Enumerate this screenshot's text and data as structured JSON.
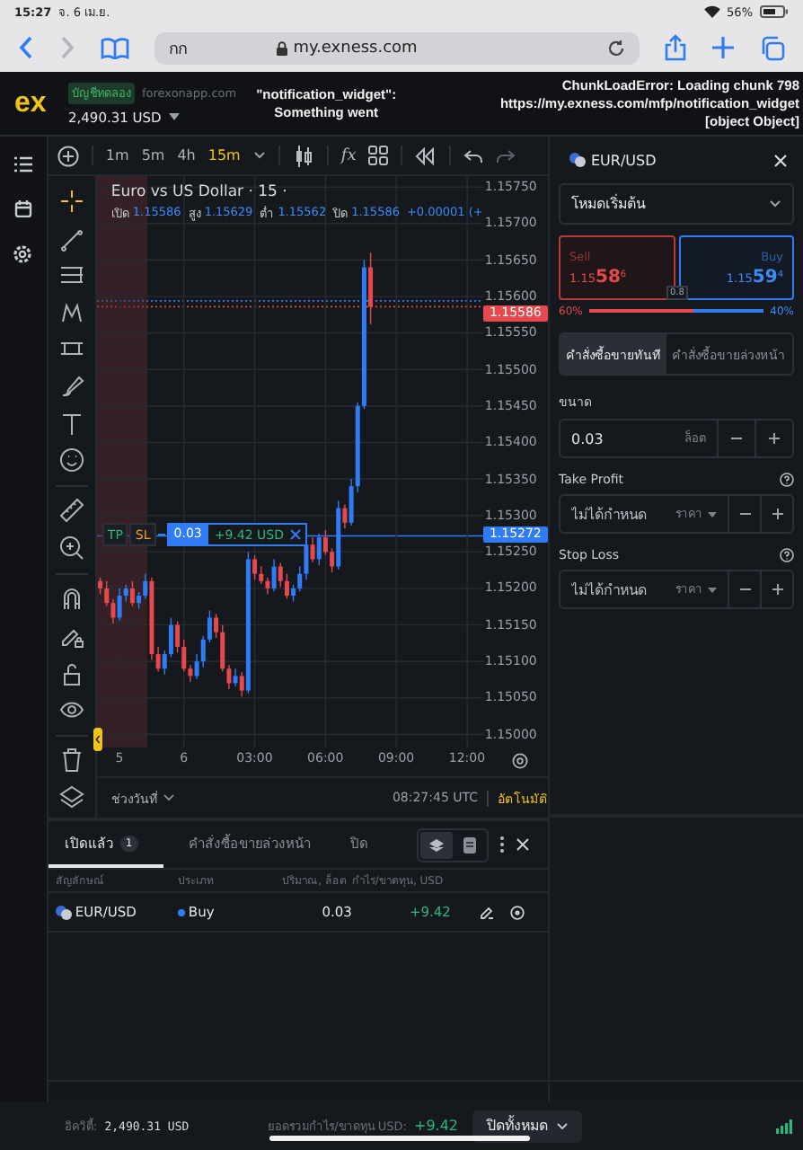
{
  "status_bar": {
    "time": "15:27",
    "date": "จ. 6 เม.ย.",
    "battery": "56%"
  },
  "browser": {
    "address_text": "กก",
    "url": "my.exness.com"
  },
  "app_header": {
    "logo": "ex",
    "account_badge": "บัญชีทดลอง",
    "site": "forexonapp.com",
    "balance": "2,490.31 USD",
    "error_notices": [
      {
        "lines": [
          "\"notification_widget\":",
          "Something went"
        ]
      },
      {
        "lines": [
          "ChunkLoadError: Loading chunk 798",
          "https://my.exness.com/mfp/notification_widget",
          "[object Object]"
        ]
      }
    ]
  },
  "chart_toolbar": {
    "intervals": [
      {
        "label": "1m",
        "selected": false
      },
      {
        "label": "5m",
        "selected": false
      },
      {
        "label": "4h",
        "selected": false
      },
      {
        "label": "15m",
        "selected": true
      }
    ],
    "indicators": "fx"
  },
  "chart": {
    "title": "Euro vs US Dollar · 15 ·",
    "ohlc": [
      {
        "label": "เปิด",
        "value": "1.15586"
      },
      {
        "label": "สูง",
        "value": "1.15629"
      },
      {
        "label": "ต่ำ",
        "value": "1.15562"
      },
      {
        "label": "ปิด",
        "value": "1.15586"
      }
    ],
    "change": "+0.00001 (+",
    "chart_data": {
      "type": "candlestick",
      "categories": [
        null,
        null,
        null,
        "5",
        null,
        null,
        null,
        null,
        null,
        null,
        null,
        null,
        null,
        "6",
        null,
        null,
        null,
        null,
        null,
        null,
        null,
        null,
        null,
        null,
        "03:00",
        null,
        null,
        null,
        null,
        null,
        null,
        null,
        null,
        null,
        null,
        "06:00",
        null,
        null,
        null,
        null,
        null,
        null,
        null,
        null,
        null,
        null,
        "09:00",
        null,
        null,
        null,
        null,
        null,
        null,
        null,
        null,
        null,
        null,
        "12:00",
        null,
        null
      ],
      "ohlc": [
        [
          1.1521,
          1.15215,
          1.15192,
          1.152
        ],
        [
          1.152,
          1.1521,
          1.15176,
          1.1518
        ],
        [
          1.1518,
          1.15185,
          1.15152,
          1.1516
        ],
        [
          1.1516,
          1.152,
          1.15156,
          1.1519
        ],
        [
          1.1519,
          1.15205,
          1.15182,
          1.152
        ],
        [
          1.152,
          1.1521,
          1.15176,
          1.1518
        ],
        [
          1.1518,
          1.15195,
          1.15172,
          1.1519
        ],
        [
          1.1519,
          1.1522,
          1.15186,
          1.1521
        ],
        [
          1.1521,
          1.15215,
          1.15102,
          1.1511
        ],
        [
          1.1511,
          1.1512,
          1.15086,
          1.1509
        ],
        [
          1.1509,
          1.15115,
          1.15082,
          1.1511
        ],
        [
          1.1511,
          1.1516,
          1.15106,
          1.1515
        ],
        [
          1.1515,
          1.15155,
          1.15112,
          1.1512
        ],
        [
          1.1512,
          1.1513,
          1.15086,
          1.1509
        ],
        [
          1.1509,
          1.15095,
          1.15072,
          1.1508
        ],
        [
          1.1508,
          1.1511,
          1.15076,
          1.151
        ],
        [
          1.151,
          1.15135,
          1.15092,
          1.1513
        ],
        [
          1.1513,
          1.1517,
          1.15126,
          1.1516
        ],
        [
          1.1516,
          1.15165,
          1.15132,
          1.1514
        ],
        [
          1.1514,
          1.1515,
          1.15086,
          1.1509
        ],
        [
          1.1509,
          1.15095,
          1.15062,
          1.1507
        ],
        [
          1.1507,
          1.1509,
          1.15066,
          1.1508
        ],
        [
          1.1508,
          1.15085,
          1.15052,
          1.1506
        ],
        [
          1.1506,
          1.1525,
          1.15056,
          1.1524
        ],
        [
          1.1524,
          1.15245,
          1.15212,
          1.1522
        ],
        [
          1.1522,
          1.1523,
          1.15206,
          1.1521
        ],
        [
          1.1521,
          1.15215,
          1.15192,
          1.152
        ],
        [
          1.152,
          1.1524,
          1.15196,
          1.1523
        ],
        [
          1.1523,
          1.15235,
          1.15202,
          1.1521
        ],
        [
          1.1521,
          1.1522,
          1.15186,
          1.1519
        ],
        [
          1.1519,
          1.15205,
          1.15182,
          1.152
        ],
        [
          1.152,
          1.1523,
          1.15196,
          1.1522
        ],
        [
          1.1522,
          1.15265,
          1.15212,
          1.1526
        ],
        [
          1.1526,
          1.1527,
          1.15236,
          1.1524
        ],
        [
          1.1524,
          1.15275,
          1.15232,
          1.1527
        ],
        [
          1.1527,
          1.1528,
          1.15246,
          1.1525
        ],
        [
          1.1525,
          1.15255,
          1.15222,
          1.1523
        ],
        [
          1.1523,
          1.1532,
          1.15226,
          1.1531
        ],
        [
          1.1531,
          1.15315,
          1.15282,
          1.1529
        ],
        [
          1.1529,
          1.1535,
          1.15286,
          1.1534
        ],
        [
          1.1534,
          1.15455,
          1.15332,
          1.1545
        ],
        [
          1.1545,
          1.1565,
          1.15446,
          1.1564
        ],
        [
          1.1564,
          1.1566,
          1.15562,
          1.15586
        ],
        null,
        null,
        null,
        null,
        null,
        null,
        null,
        null,
        null,
        null,
        null,
        null,
        null,
        null,
        null,
        null,
        null
      ],
      "ylim": [
        1.14982,
        1.15765
      ],
      "grid": true,
      "yticks": [
        {
          "value": 1.1575,
          "label": "1.15750"
        },
        {
          "value": 1.157,
          "label": "1.15700"
        },
        {
          "value": 1.1565,
          "label": "1.15650"
        },
        {
          "value": 1.156,
          "label": "1.15600"
        },
        {
          "value": 1.1555,
          "label": "1.15550"
        },
        {
          "value": 1.155,
          "label": "1.15500"
        },
        {
          "value": 1.1545,
          "label": "1.15450"
        },
        {
          "value": 1.154,
          "label": "1.15400"
        },
        {
          "value": 1.1535,
          "label": "1.15350"
        },
        {
          "value": 1.153,
          "label": "1.15300"
        },
        {
          "value": 1.1525,
          "label": "1.15250"
        },
        {
          "value": 1.152,
          "label": "1.15200"
        },
        {
          "value": 1.1515,
          "label": "1.15150"
        },
        {
          "value": 1.151,
          "label": "1.15100"
        },
        {
          "value": 1.1505,
          "label": "1.15050"
        },
        {
          "value": 1.15,
          "label": "1.15000"
        }
      ]
    },
    "current_price": "1.15586",
    "position_price": "1.15272",
    "position": {
      "tp": "TP",
      "sl": "SL",
      "volume": "0.03",
      "profit": "+9.42 USD"
    }
  },
  "chart_footer": {
    "range": "ช่วงวันที่",
    "time": "08:27:45 UTC",
    "scale_mode": "อัตโนมัติ"
  },
  "order_panel": {
    "symbol": "EUR/USD",
    "mode": "โหมดเริ่มต้น",
    "sell": {
      "label": "Sell",
      "prefix": "1.15",
      "big": "58",
      "sup": "6"
    },
    "buy": {
      "label": "Buy",
      "prefix": "1.15",
      "big": "59",
      "sup": "4"
    },
    "spread": "0.8",
    "sentiment": {
      "sell": "60%",
      "buy": "40%",
      "level": 0.6
    },
    "order_tabs": [
      {
        "label": "คำสั่งซื้อขายทันที",
        "selected": true
      },
      {
        "label": "คำสั่งซื้อขายล่วงหน้า",
        "selected": false
      }
    ],
    "volume": {
      "label": "ขนาด",
      "value": "0.03",
      "unit": "ล็อต"
    },
    "take_profit": {
      "label": "Take Profit",
      "placeholder": "ไม่ได้กำหนด",
      "mode": "ราคา"
    },
    "stop_loss": {
      "label": "Stop Loss",
      "placeholder": "ไม่ได้กำหนด",
      "mode": "ราคา"
    }
  },
  "positions": {
    "tabs": [
      {
        "label": "เปิดแล้ว",
        "count": "1",
        "selected": true
      },
      {
        "label": "คำสั่งซื้อขายล่วงหน้า",
        "selected": false
      },
      {
        "label": "ปิด",
        "selected": false
      }
    ],
    "view_toggle": [
      {
        "selected": true
      },
      {
        "selected": false
      }
    ],
    "columns": [
      "สัญลักษณ์",
      "ประเภท",
      "ปริมาณ, ล็อต",
      "กำไร/ขาดทุน, USD"
    ],
    "rows": [
      {
        "symbol": "EUR/USD",
        "type": "Buy",
        "volume": "0.03",
        "profit": "+9.42"
      }
    ]
  },
  "footer": {
    "equity_label": "อิควิตี้:",
    "equity": "2,490.31 USD",
    "total_label": "ยอดรวมกำไร/ขาดทุน USD:",
    "total": "+9.42",
    "close_all": "ปิดทั้งหมด"
  }
}
